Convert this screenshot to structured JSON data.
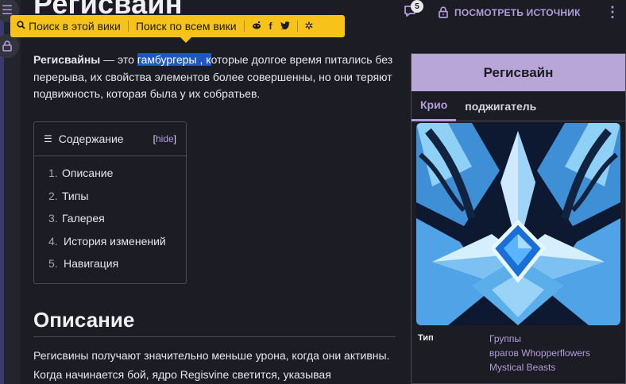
{
  "page": {
    "title": "Регисвайн"
  },
  "search_popup": {
    "search_wiki": "Поиск в этой вики",
    "search_all": "Поиск по всем вики",
    "social": [
      "reddit-icon",
      "facebook-icon",
      "twitter-icon"
    ],
    "settings_icon": "gear-icon"
  },
  "header": {
    "comment_count": "5",
    "view_source": "ПОСМОТРЕТЬ ИСТОЧНИК"
  },
  "intro": {
    "bold_term": "Регисвайны",
    "dash": " — это ",
    "highlight": "гамбургеры , к",
    "rest": "оторые долгое время питались без перерыва, их свойства элементов более совершенны, но они теряют подвижность, которая была у их собратьев."
  },
  "toc": {
    "title": "Содержание",
    "hide_open": "[",
    "hide_label": "hide",
    "hide_close": "]",
    "items": [
      {
        "num": "1.",
        "label": "Описание"
      },
      {
        "num": "2.",
        "label": "Типы"
      },
      {
        "num": "3.",
        "label": "Галерея"
      },
      {
        "num": "4.",
        "label": "История изменений"
      },
      {
        "num": "5.",
        "label": "Навигация"
      }
    ]
  },
  "section": {
    "title": "Описание",
    "text": "Регисвины получают значительно меньше урона, когда они активны. Когда начинается бой, ядро Regisvine светится, указывая"
  },
  "infobox": {
    "title": "Регисвайн",
    "tabs": [
      "Крио",
      "поджигатель"
    ],
    "type_label": "Тип",
    "type_values": [
      "Группы",
      "врагов Whopperflowers",
      "Mystical Beasts"
    ]
  },
  "colors": {
    "accent": "#b39ddb",
    "popup": "#f7c31a",
    "highlight": "#1f57c3",
    "infobox_header": "#b9a6d9"
  }
}
